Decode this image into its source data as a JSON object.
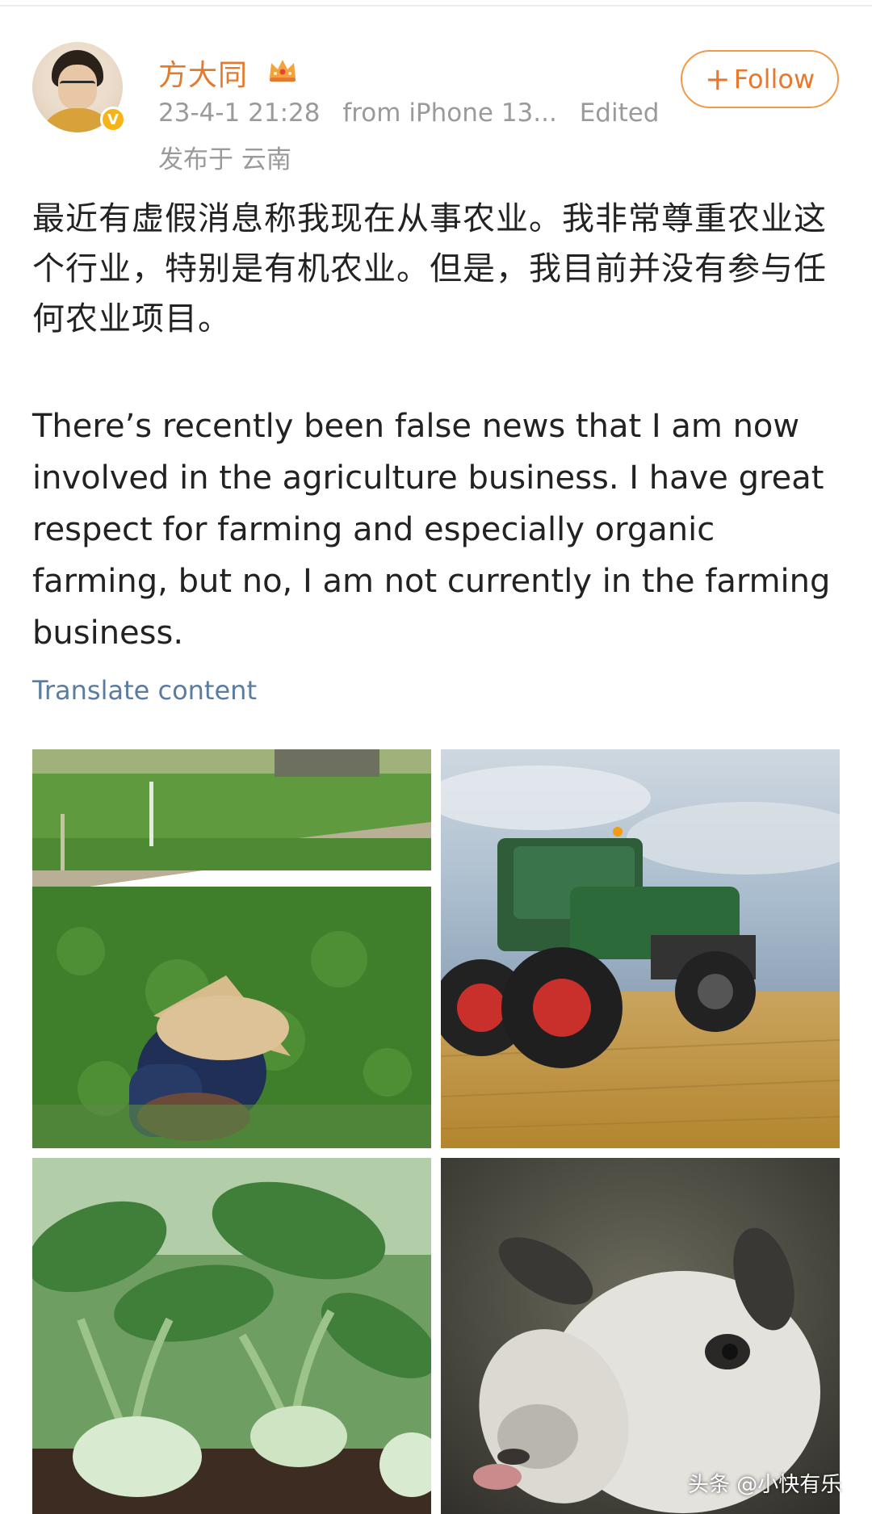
{
  "post": {
    "username": "方大同",
    "timestamp": "23-4-1 21:28",
    "source": "from iPhone 13...",
    "edited": "Edited",
    "location": "发布于 云南",
    "follow_label": "Follow",
    "text_zh": "最近有虚假消息称我现在从事农业。我非常尊重农业这个行业，特别是有机农业。但是，我目前并没有参与任何农业项目。",
    "text_en": "There’s recently been false news that I am now involved in the agriculture business. I have great respect for farming and especially organic farming, but no, I am not currently in the farming business.",
    "translate_label": "Translate content",
    "verified_badge": "V"
  },
  "images": [
    {
      "subject": "farmer-in-field"
    },
    {
      "subject": "green-tractor"
    },
    {
      "subject": "kohlrabi-plants"
    },
    {
      "subject": "goat"
    }
  ],
  "watermark": "头条 @小快有乐",
  "colors": {
    "username": "#e5792d",
    "follow_border": "#f09a4a",
    "meta_text": "#9a9a9a",
    "translate_link": "#5b7c9e",
    "body_text": "#222222"
  },
  "icons": [
    "avatar",
    "verified-badge-icon",
    "crown-icon",
    "plus-icon"
  ]
}
